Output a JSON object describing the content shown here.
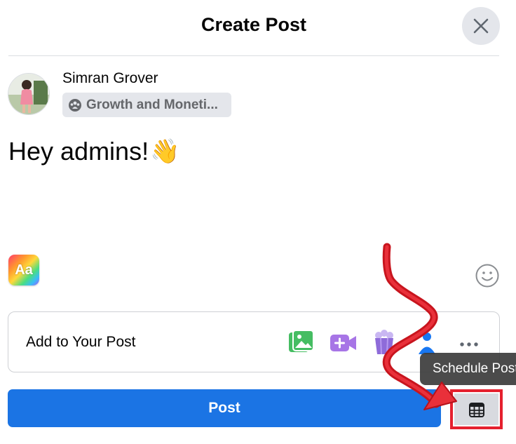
{
  "dialog": {
    "title": "Create Post"
  },
  "user": {
    "name": "Simran Grover",
    "audience": "Growth and Moneti..."
  },
  "composer": {
    "text": "Hey admins!",
    "emoji": "👋"
  },
  "toolbar": {
    "text_style_label": "Aa"
  },
  "add_to_post": {
    "label": "Add to Your Post",
    "icons": [
      "photo-video-icon",
      "live-video-icon",
      "popcorn-icon",
      "tag-people-icon",
      "more-icon"
    ]
  },
  "actions": {
    "post_label": "Post",
    "schedule_tooltip": "Schedule Post"
  },
  "colors": {
    "primary": "#1b74e4",
    "annotation_red": "#e5202e",
    "photo_green": "#45bd62",
    "video_purple": "#a775e6"
  }
}
